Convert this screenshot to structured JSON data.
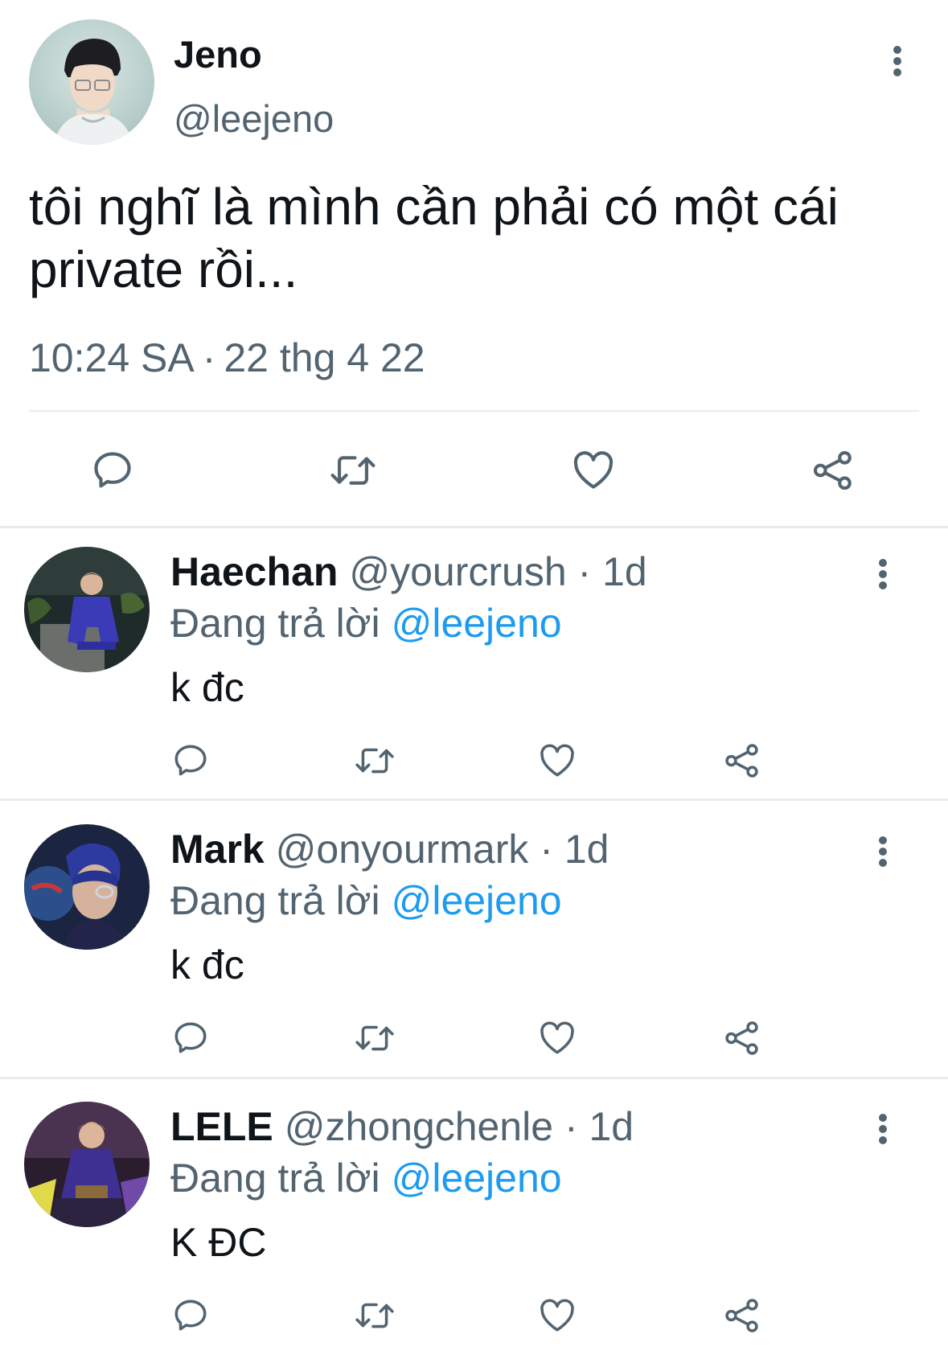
{
  "main_tweet": {
    "name": "Jeno",
    "handle": "@leejeno",
    "text": "tôi nghĩ là mình cần phải có một cái private rồi...",
    "time": "10:24 SA",
    "separator": "·",
    "date": "22 thg 4 22",
    "avatar_icon": "profile-photo",
    "more_icon": "more-vertical-icon"
  },
  "action_icons": [
    "reply-icon",
    "retweet-icon",
    "like-icon",
    "share-icon"
  ],
  "replies": [
    {
      "name": "Haechan",
      "handle": "@yourcrush",
      "separator": "·",
      "time": "1d",
      "replying_label": "Đang trả lời",
      "replying_to": "@leejeno",
      "text": "k đc"
    },
    {
      "name": "Mark",
      "handle": "@onyourmark",
      "separator": "·",
      "time": "1d",
      "replying_label": "Đang trả lời",
      "replying_to": "@leejeno",
      "text": "k đc"
    },
    {
      "name": "LELE",
      "handle": "@zhongchenle",
      "separator": "·",
      "time": "1d",
      "replying_label": "Đang trả lời",
      "replying_to": "@leejeno",
      "text": "K ĐC"
    }
  ],
  "colors": {
    "text": "#0f1419",
    "secondary": "#536471",
    "link": "#1d9bf0",
    "divider": "#e6ecf0"
  }
}
